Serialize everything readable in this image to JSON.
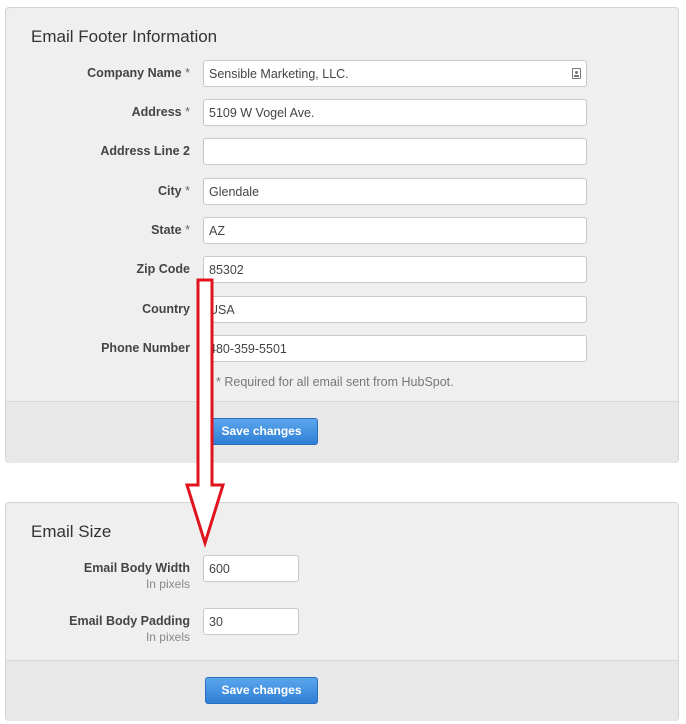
{
  "email_footer": {
    "title": "Email Footer Information",
    "fields": [
      {
        "label": "Company Name",
        "required": true,
        "value": "Sensible Marketing, LLC."
      },
      {
        "label": "Address",
        "required": true,
        "value": "5109 W Vogel Ave."
      },
      {
        "label": "Address Line 2",
        "required": false,
        "value": ""
      },
      {
        "label": "City",
        "required": true,
        "value": "Glendale"
      },
      {
        "label": "State",
        "required": true,
        "value": "AZ"
      },
      {
        "label": "Zip Code",
        "required": false,
        "value": "85302"
      },
      {
        "label": "Country",
        "required": false,
        "value": "USA"
      },
      {
        "label": "Phone Number",
        "required": false,
        "value": "480-359-5501"
      }
    ],
    "required_marker": "*",
    "help_text": "Required for all email sent from HubSpot.",
    "save_label": "Save changes"
  },
  "email_size": {
    "title": "Email Size",
    "fields": [
      {
        "label": "Email Body Width",
        "sublabel": "In pixels",
        "value": "600"
      },
      {
        "label": "Email Body Padding",
        "sublabel": "In pixels",
        "value": "30"
      }
    ],
    "save_label": "Save changes"
  },
  "annotation": {
    "arrow_color": "#e0141e"
  }
}
